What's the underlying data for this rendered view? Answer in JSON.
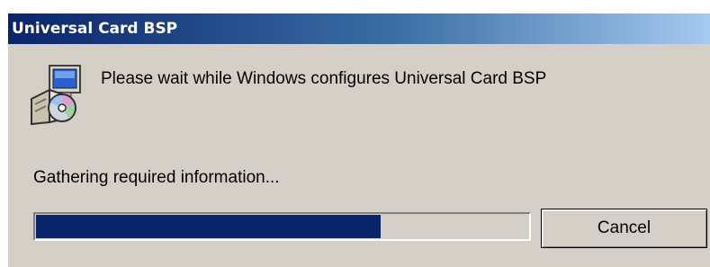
{
  "window": {
    "title": "Universal Card BSP",
    "icon": "installer-setup-icon"
  },
  "dialog": {
    "message": "Please wait while Windows configures Universal Card BSP",
    "status": "Gathering required information...",
    "progress_percent": 70
  },
  "buttons": {
    "cancel_label": "Cancel"
  },
  "colors": {
    "titlebar_start": "#0a246a",
    "titlebar_end": "#a6caf0",
    "dialog_background": "#d4d0c8",
    "progress_fill": "#0a246a"
  }
}
